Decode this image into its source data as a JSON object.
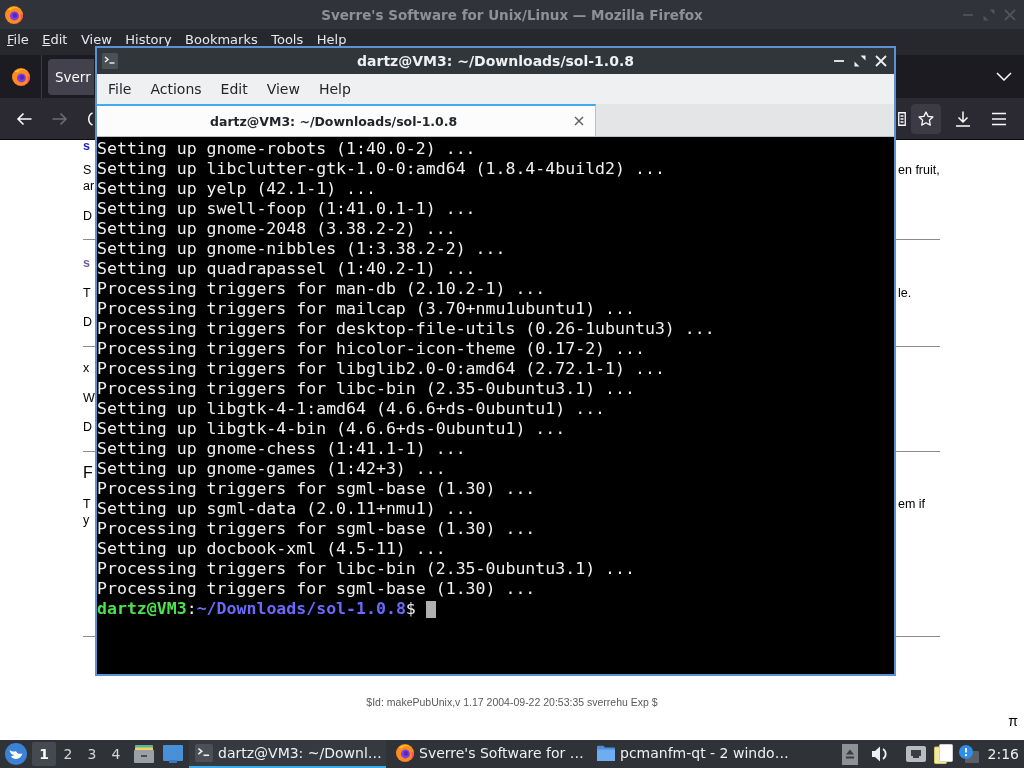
{
  "browser": {
    "title": "Sverre's Software for Unix/Linux — Mozilla Firefox",
    "menu": [
      {
        "label": "File",
        "underlined": true
      },
      {
        "label": "Edit",
        "underlined": true
      },
      {
        "label": "View",
        "underlined": false
      },
      {
        "label": "History",
        "underlined": false
      },
      {
        "label": "Bookmarks",
        "underlined": false
      },
      {
        "label": "Tools",
        "underlined": false
      },
      {
        "label": "Help",
        "underlined": false
      }
    ],
    "tab": {
      "label": "Sverr",
      "selected": true
    },
    "nav_buttons": [
      {
        "kind": "back",
        "disabled": false
      },
      {
        "kind": "forward",
        "disabled": true
      }
    ],
    "page": {
      "blocks": [
        {
          "kind": "link",
          "text": "s",
          "visited": false
        },
        {
          "kind": "paragraph",
          "lines": [
            {
              "left": "S",
              "right": "en fruit,"
            },
            {
              "left": "ar"
            }
          ]
        },
        {
          "kind": "paragraph",
          "lines": [
            {
              "left": "D"
            }
          ]
        },
        {
          "kind": "rule"
        },
        {
          "kind": "link",
          "text": "s",
          "visited": true
        },
        {
          "kind": "paragraph",
          "lines": [
            {
              "left": "T",
              "right": "le."
            }
          ]
        },
        {
          "kind": "paragraph",
          "lines": [
            {
              "left": "D"
            }
          ]
        },
        {
          "kind": "rule"
        },
        {
          "kind": "paragraph",
          "lines": [
            {
              "left": "x"
            }
          ]
        },
        {
          "kind": "paragraph",
          "lines": [
            {
              "left": "W"
            }
          ]
        },
        {
          "kind": "paragraph",
          "lines": [
            {
              "left": "D"
            }
          ]
        },
        {
          "kind": "rule"
        },
        {
          "kind": "heading",
          "lines": [
            {
              "left": "F"
            }
          ]
        },
        {
          "kind": "paragraph",
          "lines": [
            {
              "left": "T",
              "right": "em if"
            },
            {
              "left": "y"
            }
          ]
        }
      ],
      "footer": "$Id: makePubUnix,v 1.17 2004-09-22 20:53:35 sverrehu Exp $",
      "corner_symbol": "π"
    }
  },
  "terminal": {
    "title": "dartz@VM3: ~/Downloads/sol-1.0.8",
    "menu": [
      "File",
      "Actions",
      "Edit",
      "View",
      "Help"
    ],
    "tabs": [
      {
        "label": "dartz@VM3: ~/Downloads/sol-1.0.8",
        "selected": true
      }
    ],
    "lines": [
      "Setting up gnome-robots (1:40.0-2) ...",
      "Setting up libclutter-gtk-1.0-0:amd64 (1.8.4-4build2) ...",
      "Setting up yelp (42.1-1) ...",
      "Setting up swell-foop (1:41.0.1-1) ...",
      "Setting up gnome-2048 (3.38.2-2) ...",
      "Setting up gnome-nibbles (1:3.38.2-2) ...",
      "Setting up quadrapassel (1:40.2-1) ...",
      "Processing triggers for man-db (2.10.2-1) ...",
      "Processing triggers for mailcap (3.70+nmu1ubuntu1) ...",
      "Processing triggers for desktop-file-utils (0.26-1ubuntu3) ...",
      "Processing triggers for hicolor-icon-theme (0.17-2) ...",
      "Processing triggers for libglib2.0-0:amd64 (2.72.1-1) ...",
      "Processing triggers for libc-bin (2.35-0ubuntu3.1) ...",
      "Setting up libgtk-4-1:amd64 (4.6.6+ds-0ubuntu1) ...",
      "Setting up libgtk-4-bin (4.6.6+ds-0ubuntu1) ...",
      "Setting up gnome-chess (1:41.1-1) ...",
      "Setting up gnome-games (1:42+3) ...",
      "Processing triggers for sgml-base (1.30) ...",
      "Setting up sgml-data (2.0.11+nmu1) ...",
      "Processing triggers for sgml-base (1.30) ...",
      "Setting up docbook-xml (4.5-11) ...",
      "Processing triggers for libc-bin (2.35-0ubuntu3.1) ...",
      "Processing triggers for sgml-base (1.30) ..."
    ],
    "prompt": {
      "user_host": "dartz@VM3",
      "separator": ":",
      "path": "~/Downloads/sol-1.0.8",
      "symbol": "$"
    }
  },
  "taskbar": {
    "desktops": [
      {
        "label": "1",
        "selected": true
      },
      {
        "label": "2",
        "selected": false
      },
      {
        "label": "3",
        "selected": false
      },
      {
        "label": "4",
        "selected": false
      }
    ],
    "tasks": [
      {
        "kind": "terminal",
        "label": "dartz@VM3: ~/Downl…",
        "selected": true
      },
      {
        "kind": "browser",
        "label": "Sverre's Software for …",
        "selected": false
      },
      {
        "kind": "folder",
        "label": "pcmanfm-qt - 2 windo…",
        "selected": false
      }
    ],
    "clock": "2:16"
  }
}
